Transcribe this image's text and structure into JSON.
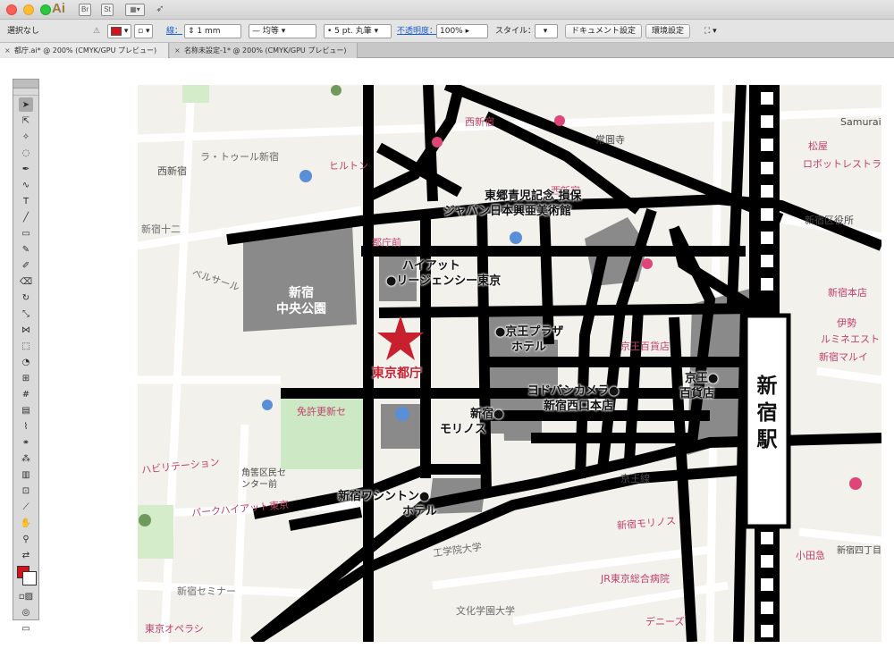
{
  "app": {
    "logo": "Ai",
    "icons": [
      "Br",
      "St"
    ]
  },
  "control_bar": {
    "selection_status": "選択なし",
    "stroke_label": "線：",
    "stroke_width": "1 mm",
    "profile": "均等",
    "brush": "5 pt. 丸筆",
    "opacity_label": "不透明度：",
    "opacity_value": "100%",
    "style_label": "スタイル：",
    "doc_settings": "ドキュメント設定",
    "prefs": "環境設定",
    "fill_color": "#d4141c"
  },
  "tabs": [
    {
      "label": "都庁.ai* @ 200% (CMYK/GPU プレビュー)",
      "active": true
    },
    {
      "label": "名称未設定-1* @ 200% (CMYK/GPU プレビュー)",
      "active": false
    }
  ],
  "map": {
    "park": [
      "新宿",
      "中央公園"
    ],
    "station": [
      "新",
      "宿",
      "駅"
    ],
    "star_label": "東京都庁",
    "labels": {
      "seiji_museum": [
        "東郷青児記念 損保",
        "ジャパン日本興亜美術館"
      ],
      "hyatt": [
        "ハイアット",
        "●リージェンシー東京"
      ],
      "keio_plaza": [
        "●京王プラザ",
        "ホテル"
      ],
      "keio_dept": [
        "京王●",
        "百貨店"
      ],
      "yodobashi": [
        "ヨドバシカメラ●",
        "新宿西口本店"
      ],
      "sumitomo": [
        "新宿●",
        "モリノス"
      ],
      "washington": [
        "新宿ワシントン●",
        "ホテル"
      ]
    },
    "background_labels": [
      "西新宿",
      "ラ・トゥール新宿",
      "西新宿",
      "新宿十二",
      "ベルサール",
      "常圓寺",
      "新宿区役所",
      "新宿本店",
      "新宿マルイ",
      "伊勢",
      "ルミネエスト",
      "小田急",
      "京王線",
      "角筈区民センター前",
      "パークハイアット東京",
      "ハビリテーション",
      "免許更新セ",
      "新宿セミナー",
      "東京オペラシ",
      "工学院大学",
      "文化学園大学",
      "JR東京総合病院",
      "デニーズ",
      "ロボットレストラ",
      "Samurai",
      "松屋",
      "新宿四丁目",
      "新宿モリノス",
      "都庁前",
      "京王百貨店",
      "ヒルトン",
      "西新宿"
    ]
  }
}
